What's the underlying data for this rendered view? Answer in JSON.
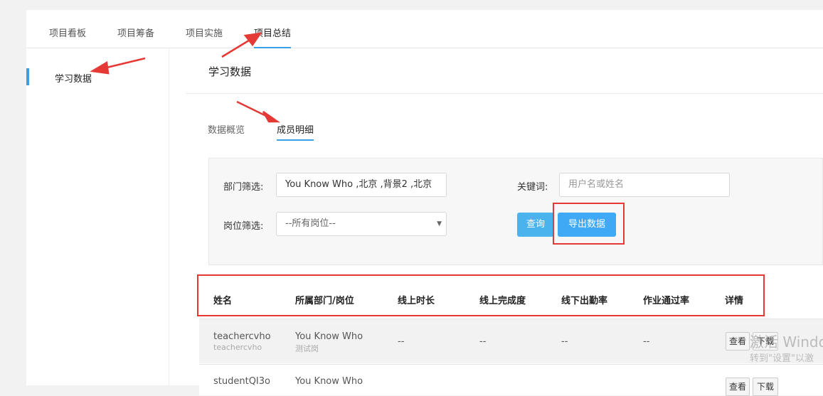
{
  "top_tabs": [
    "项目看板",
    "项目筹备",
    "项目实施",
    "项目总结"
  ],
  "sidebar": {
    "items": [
      {
        "label": "学习数据"
      }
    ]
  },
  "main": {
    "title": "学习数据",
    "sub_tabs": [
      "数据概览",
      "成员明细"
    ]
  },
  "filters": {
    "dept_label": "部门筛选:",
    "dept_value": "You Know Who ,北京 ,背景2 ,北京",
    "keyword_label": "关键词:",
    "keyword_placeholder": "用户名或姓名",
    "position_label": "岗位筛选:",
    "position_value": "--所有岗位--",
    "query_label": "查询",
    "export_label": "导出数据"
  },
  "table": {
    "headers": [
      "姓名",
      "所属部门/岗位",
      "线上时长",
      "线上完成度",
      "线下出勤率",
      "作业通过率",
      "详情"
    ],
    "rows": [
      {
        "name": "teachercvho",
        "name_sub": "teachercvho",
        "dept": "You Know Who",
        "dept_sub": "测试岗",
        "online_hours": "--",
        "online_completion": "--",
        "offline_attendance": "--",
        "homework_pass": "--",
        "view_label": "查看",
        "download_label": "下载"
      },
      {
        "name": "studentQI3o",
        "dept": "You Know Who",
        "view_label": "查看",
        "download_label": "下载"
      }
    ]
  },
  "watermark": {
    "line1": "激活 Windo",
    "line2": "转到\"设置\"以激"
  },
  "colors": {
    "accent": "#3aa1e6",
    "button": "#4ab3ee",
    "annotation": "#e53935"
  }
}
